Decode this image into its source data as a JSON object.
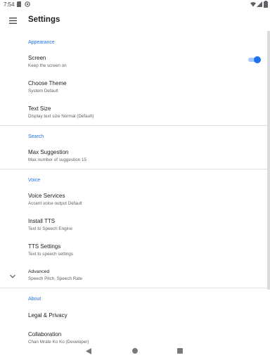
{
  "status_bar": {
    "time": "7:54",
    "icons": [
      "sd-card-icon",
      "circle-icon",
      "wifi-icon",
      "signal-icon",
      "battery-icon"
    ]
  },
  "toolbar": {
    "title": "Settings",
    "menu_icon": "hamburger-menu-icon"
  },
  "sections": {
    "appearance": {
      "header": "Appearance",
      "items": [
        {
          "title": "Screen",
          "summary": "Keep the screen on",
          "toggle_on": true
        },
        {
          "title": "Choose Theme",
          "summary": "System Default"
        },
        {
          "title": "Text Size",
          "summary": "Display text size Normal (Default)"
        }
      ]
    },
    "search": {
      "header": "Search",
      "items": [
        {
          "title": "Max Suggestion",
          "summary": "Max number of suggestion 15"
        }
      ]
    },
    "voice": {
      "header": "Voice",
      "items": [
        {
          "title": "Voice Services",
          "summary": "Accent voice output Default"
        },
        {
          "title": "Install TTS",
          "summary": "Text to Speech Engine"
        },
        {
          "title": "TTS Settings",
          "summary": "Text to speech settings"
        },
        {
          "title": "Advanced",
          "summary": "Speech Pitch, Speech Rate",
          "icon": "chevron-down-icon"
        }
      ]
    },
    "about": {
      "header": "About",
      "items": [
        {
          "title": "Legal & Privacy"
        },
        {
          "title": "Collaboration",
          "summary": "Chan Mrate Ko Ko (Developer)"
        }
      ]
    }
  },
  "colors": {
    "accent": "#1a73e8",
    "toggle_track": "#a8c7fa",
    "divider": "#e0e0e0",
    "secondary_text": "#5f6368"
  },
  "nav_bar": {
    "icons": [
      "back-icon",
      "home-icon",
      "recents-icon"
    ]
  }
}
